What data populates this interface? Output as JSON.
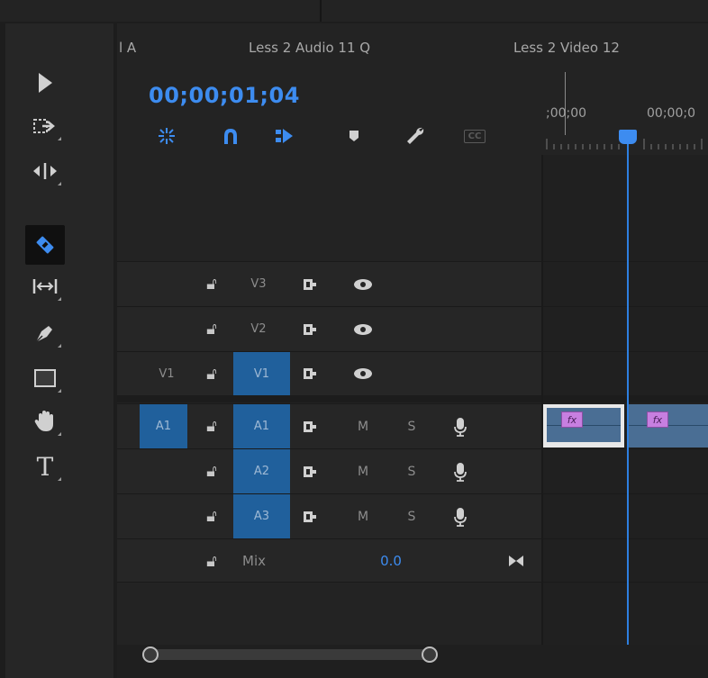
{
  "sequence_tabs": [
    {
      "label": "l A"
    },
    {
      "label": "Less 2 Audio 11 Q"
    },
    {
      "label": "Less 2 Video 12"
    }
  ],
  "timecode": "00;00;01;04",
  "ruler": {
    "labels": [
      ";00;00",
      "00;00;0"
    ]
  },
  "tools": [
    {
      "name": "selection-tool-icon"
    },
    {
      "name": "track-select-forward-tool-icon"
    },
    {
      "name": "ripple-edit-tool-icon"
    },
    {
      "name": "razor-tool-icon",
      "active": true
    },
    {
      "name": "slip-tool-icon"
    },
    {
      "name": "pen-tool-icon"
    },
    {
      "name": "rectangle-tool-icon"
    },
    {
      "name": "hand-tool-icon"
    },
    {
      "name": "type-tool-icon",
      "glyph": "T"
    }
  ],
  "timeline_controls": [
    {
      "name": "nest-insert-icon"
    },
    {
      "name": "snap-icon"
    },
    {
      "name": "linked-selection-icon"
    },
    {
      "name": "add-marker-icon"
    },
    {
      "name": "timeline-settings-icon"
    },
    {
      "name": "captions-icon",
      "label": "CC"
    }
  ],
  "video_tracks": [
    {
      "source": "",
      "target": "V3",
      "targeted": false
    },
    {
      "source": "",
      "target": "V2",
      "targeted": false
    },
    {
      "source": "V1",
      "target": "V1",
      "targeted": true
    }
  ],
  "audio_tracks": [
    {
      "source": "A1",
      "target": "A1",
      "targeted": true,
      "mute": "M",
      "solo": "S"
    },
    {
      "source": "",
      "target": "A2",
      "targeted": true,
      "mute": "M",
      "solo": "S"
    },
    {
      "source": "",
      "target": "A3",
      "targeted": true,
      "mute": "M",
      "solo": "S"
    }
  ],
  "mix": {
    "label": "Mix",
    "value": "0.0"
  },
  "clips": {
    "fx_label": "fx"
  },
  "colors": {
    "accent": "#3d8cf0",
    "target_blue": "#20609c",
    "fx_badge": "#c77fe0"
  }
}
